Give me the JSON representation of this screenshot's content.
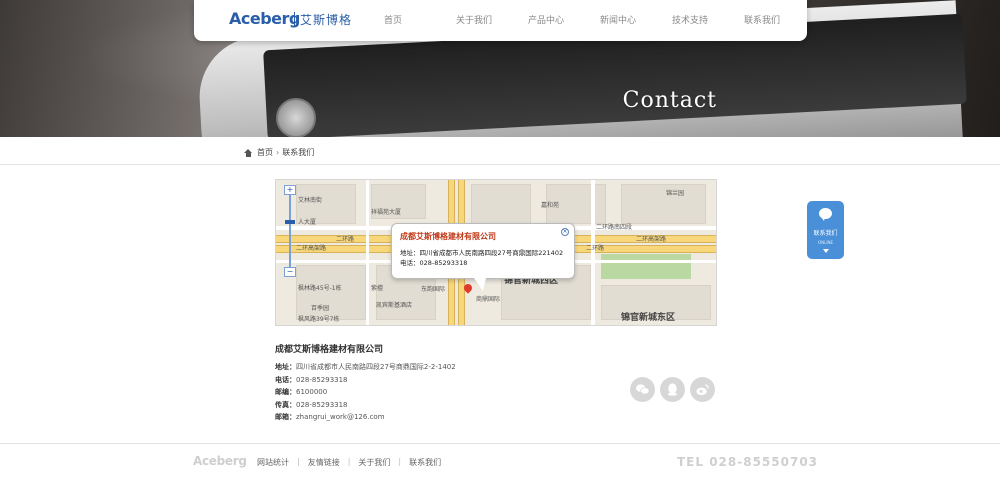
{
  "header": {
    "logo_en": "Aceberg",
    "logo_cn": "艾斯博格",
    "nav": [
      "首页",
      "关于我们",
      "产品中心",
      "新闻中心",
      "技术支持",
      "联系我们"
    ]
  },
  "banner": {
    "title": "Contact"
  },
  "breadcrumb": {
    "home": "首页",
    "current": "联系我们"
  },
  "map": {
    "popup": {
      "title": "成都艾斯博格建材有限公司",
      "address": "地址：四川省成都市人民南路四段27号商鼎国际221402",
      "phone": "电话：028-85293318"
    },
    "labels": {
      "road_erhuan_1": "二环路",
      "road_erhuan_2": "二环高架路",
      "road_erhuan_3": "二环路南四段",
      "road_erhuan_4": "二环路",
      "road_erhuan_5": "二环高架路",
      "district_west": "锦官新城西区",
      "district_east": "锦官新城东区",
      "poi_1": "艾林南街",
      "poi_2": "人大厦",
      "poi_3": "祥福苑大厦",
      "poi_4": "嘉和苑",
      "poi_5": "东韵国际",
      "poi_6": "商鼎国际",
      "poi_7": "紫檀",
      "poi_8": "枫林路45号-1栋",
      "poi_9": "百季园",
      "poi_10": "凯宾斯基酒店",
      "poi_11": "枫风路39号7栋",
      "poi_12": "锦兰园"
    }
  },
  "company": {
    "name": "成都艾斯博格建材有限公司",
    "rows": [
      {
        "label": "地址：",
        "value": "四川省成都市人民南路四段27号商鼎国际2-2-1402"
      },
      {
        "label": "电话：",
        "value": "028-85293318"
      },
      {
        "label": "邮编：",
        "value": "6100000"
      },
      {
        "label": "传真：",
        "value": "028-85293318"
      },
      {
        "label": "邮箱：",
        "value": "zhangrui_work@126.com"
      }
    ]
  },
  "float_contact": {
    "label": "联系我们",
    "sub": "ONLINE"
  },
  "footer": {
    "logo": "Aceberg",
    "links": [
      "网站统计",
      "友情链接",
      "关于我们",
      "联系我们"
    ],
    "tel": "TEL 028-85550703"
  },
  "colors": {
    "brand": "#2a5ea8",
    "float": "#4a90d9",
    "popup_title": "#c23a1a"
  },
  "icons": [
    "home-icon",
    "wechat-icon",
    "qq-icon",
    "weibo-icon",
    "chat-bubble-icon",
    "zoom-control",
    "map-pin-icon"
  ]
}
